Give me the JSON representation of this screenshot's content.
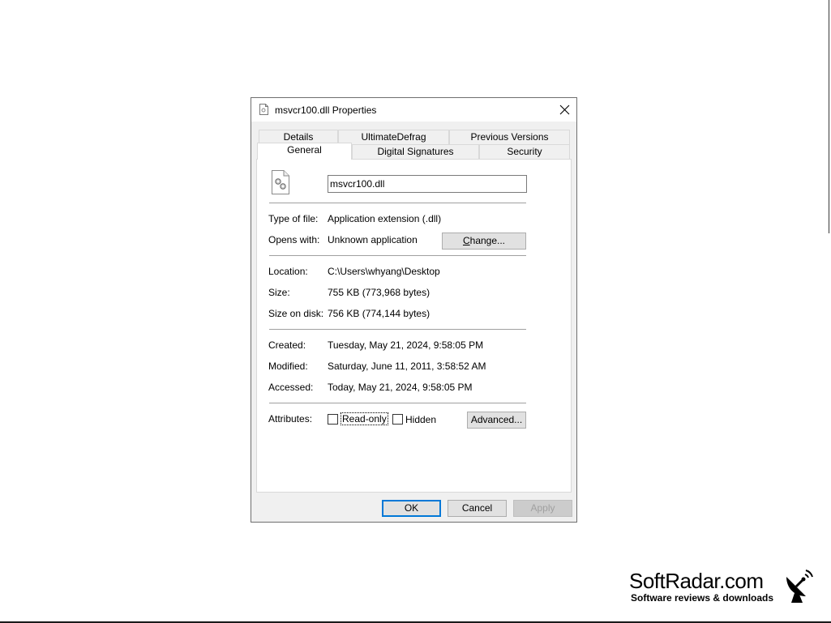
{
  "window": {
    "title": "msvcr100.dll Properties"
  },
  "tabs": {
    "row1": [
      {
        "label": "Details"
      },
      {
        "label": "UltimateDefrag"
      },
      {
        "label": "Previous Versions"
      }
    ],
    "row2": [
      {
        "label": "General",
        "active": true
      },
      {
        "label": "Digital Signatures"
      },
      {
        "label": "Security"
      }
    ]
  },
  "general": {
    "file_name": "msvcr100.dll",
    "type_label": "Type of file:",
    "type_value": "Application extension (.dll)",
    "opens_label": "Opens with:",
    "opens_value": "Unknown application",
    "change_button": "Change...",
    "location_label": "Location:",
    "location_value": "C:\\Users\\whyang\\Desktop",
    "size_label": "Size:",
    "size_value": "755 KB (773,968 bytes)",
    "size_disk_label": "Size on disk:",
    "size_disk_value": "756 KB (774,144 bytes)",
    "created_label": "Created:",
    "created_value": "Tuesday, May 21, 2024, 9:58:05 PM",
    "modified_label": "Modified:",
    "modified_value": "Saturday, June 11, 2011, 3:58:52 AM",
    "accessed_label": "Accessed:",
    "accessed_value": "Today, May 21, 2024, 9:58:05 PM",
    "attributes_label": "Attributes:",
    "readonly_label": "Read-only",
    "readonly_checked": false,
    "hidden_label": "Hidden",
    "hidden_checked": false,
    "advanced_button": "Advanced..."
  },
  "footer": {
    "ok": "OK",
    "cancel": "Cancel",
    "apply": "Apply"
  },
  "watermark": {
    "name": "SoftRadar.com",
    "tagline": "Software reviews & downloads"
  },
  "colors": {
    "focus_border": "#0078d7",
    "panel_bg": "#ffffff",
    "dialog_bg": "#f0f0f0"
  }
}
